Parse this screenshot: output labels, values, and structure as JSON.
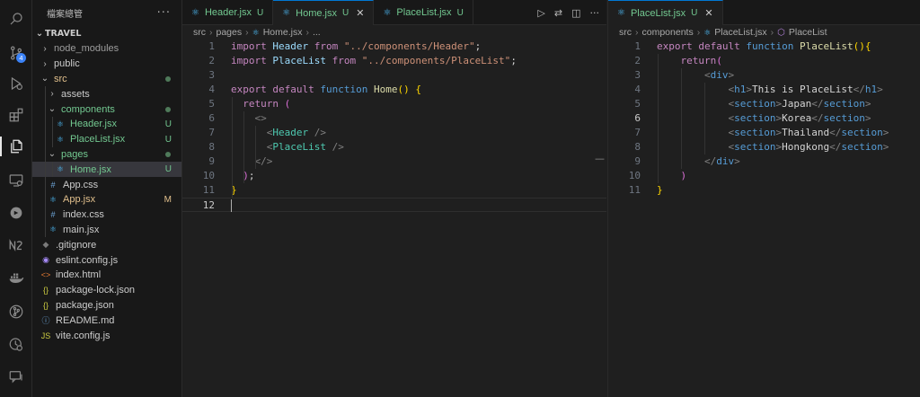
{
  "activity_bar": [
    {
      "name": "search-icon"
    },
    {
      "name": "source-control-icon",
      "badge": "4"
    },
    {
      "name": "run-debug-icon"
    },
    {
      "name": "extensions-icon"
    },
    {
      "name": "explorer-icon"
    },
    {
      "name": "remote-explorer-icon"
    },
    {
      "name": "tanstack-icon"
    },
    {
      "name": "n2-icon"
    },
    {
      "name": "docker-icon"
    },
    {
      "name": "git-graph-icon"
    },
    {
      "name": "timeline-icon"
    },
    {
      "name": "chat-icon"
    }
  ],
  "sidebar": {
    "title": "檔案總管",
    "menu": "···",
    "root": "TRAVEL",
    "items": [
      {
        "label": "node_modules",
        "depth": 1,
        "kind": "folder",
        "open": false,
        "color": "gray",
        "icon": ""
      },
      {
        "label": "public",
        "depth": 1,
        "kind": "folder",
        "open": false,
        "color": "normal",
        "icon": ""
      },
      {
        "label": "src",
        "depth": 1,
        "kind": "folder",
        "open": true,
        "color": "gold",
        "dot": true
      },
      {
        "label": "assets",
        "depth": 2,
        "kind": "folder",
        "open": false,
        "color": "normal"
      },
      {
        "label": "components",
        "depth": 2,
        "kind": "folder",
        "open": true,
        "color": "green",
        "dot": true
      },
      {
        "label": "Header.jsx",
        "depth": 3,
        "kind": "file",
        "icon": "react",
        "color": "green",
        "status": "U"
      },
      {
        "label": "PlaceList.jsx",
        "depth": 3,
        "kind": "file",
        "icon": "react",
        "color": "green",
        "status": "U"
      },
      {
        "label": "pages",
        "depth": 2,
        "kind": "folder",
        "open": true,
        "color": "green",
        "dot": true
      },
      {
        "label": "Home.jsx",
        "depth": 3,
        "kind": "file",
        "icon": "react",
        "color": "green",
        "status": "U",
        "selected": true
      },
      {
        "label": "App.css",
        "depth": 2,
        "kind": "file",
        "icon": "css",
        "color": "normal"
      },
      {
        "label": "App.jsx",
        "depth": 2,
        "kind": "file",
        "icon": "react",
        "color": "gold",
        "status": "M"
      },
      {
        "label": "index.css",
        "depth": 2,
        "kind": "file",
        "icon": "css",
        "color": "normal"
      },
      {
        "label": "main.jsx",
        "depth": 2,
        "kind": "file",
        "icon": "react",
        "color": "normal"
      },
      {
        "label": ".gitignore",
        "depth": 1,
        "kind": "file",
        "icon": "git",
        "color": "normal"
      },
      {
        "label": "eslint.config.js",
        "depth": 1,
        "kind": "file",
        "icon": "eslint",
        "color": "normal"
      },
      {
        "label": "index.html",
        "depth": 1,
        "kind": "file",
        "icon": "html",
        "color": "normal"
      },
      {
        "label": "package-lock.json",
        "depth": 1,
        "kind": "file",
        "icon": "json",
        "color": "normal"
      },
      {
        "label": "package.json",
        "depth": 1,
        "kind": "file",
        "icon": "json",
        "color": "normal"
      },
      {
        "label": "README.md",
        "depth": 1,
        "kind": "file",
        "icon": "info",
        "color": "normal"
      },
      {
        "label": "vite.config.js",
        "depth": 1,
        "kind": "file",
        "icon": "js",
        "color": "normal"
      }
    ]
  },
  "editor_left": {
    "tabs": [
      {
        "label": "Header.jsx",
        "status": "U",
        "active": false
      },
      {
        "label": "Home.jsx",
        "status": "U",
        "active": true,
        "close": "✕"
      },
      {
        "label": "PlaceList.jsx",
        "status": "U",
        "active": false
      }
    ],
    "breadcrumb": [
      "src",
      "pages",
      "Home.jsx",
      "..."
    ],
    "lines": [
      {
        "n": "1",
        "html": "<span class='kw2'>import</span> <span class='id'>Header</span> <span class='kw2'>from</span> <span class='str'>\"../components/Header\"</span><span class='plain'>;</span>"
      },
      {
        "n": "2",
        "html": "<span class='kw2'>import</span> <span class='id'>PlaceList</span> <span class='kw2'>from</span> <span class='str'>\"../components/PlaceList\"</span><span class='plain'>;</span>"
      },
      {
        "n": "3",
        "html": ""
      },
      {
        "n": "4",
        "html": "<span class='kw2'>export</span> <span class='kw2'>default</span> <span class='kw'>function</span> <span class='fn'>Home</span><span class='br1'>()</span> <span class='br1'>{</span>"
      },
      {
        "n": "5",
        "html": "  <span class='kw2'>return</span> <span class='br2'>(</span>"
      },
      {
        "n": "6",
        "html": "    <span class='pun'>&lt;&gt;</span>"
      },
      {
        "n": "7",
        "html": "      <span class='pun'>&lt;</span><span class='comp'>Header</span> <span class='pun'>/&gt;</span>"
      },
      {
        "n": "8",
        "html": "      <span class='pun'>&lt;</span><span class='comp'>PlaceList</span> <span class='pun'>/&gt;</span>"
      },
      {
        "n": "9",
        "html": "    <span class='pun'>&lt;/&gt;</span>"
      },
      {
        "n": "10",
        "html": "  <span class='br2'>)</span><span class='plain'>;</span>"
      },
      {
        "n": "11",
        "html": "<span class='br1'>}</span>"
      },
      {
        "n": "12",
        "html": "<span class='cursor'></span>",
        "current": true
      }
    ]
  },
  "editor_right": {
    "tabs": [
      {
        "label": "PlaceList.jsx",
        "status": "U",
        "active": true,
        "close": "✕"
      }
    ],
    "breadcrumb": [
      "src",
      "components",
      "PlaceList.jsx",
      "PlaceList"
    ],
    "lines": [
      {
        "n": "1",
        "html": "<span class='kw2'>export</span> <span class='kw2'>default</span> <span class='kw'>function</span> <span class='fn'>PlaceList</span><span class='br1'>(){</span>"
      },
      {
        "n": "2",
        "html": "    <span class='kw2'>return</span><span class='br2'>(</span>"
      },
      {
        "n": "3",
        "html": "        <span class='pun'>&lt;</span><span class='tag'>div</span><span class='pun'>&gt;</span>"
      },
      {
        "n": "4",
        "html": "            <span class='pun'>&lt;</span><span class='tag'>h1</span><span class='pun'>&gt;</span><span class='plain'>This is PlaceList</span><span class='pun'>&lt;/</span><span class='tag'>h1</span><span class='pun'>&gt;</span>"
      },
      {
        "n": "5",
        "html": "            <span class='pun'>&lt;</span><span class='tag'>section</span><span class='pun'>&gt;</span><span class='plain'>Japan</span><span class='pun'>&lt;/</span><span class='tag'>section</span><span class='pun'>&gt;</span>"
      },
      {
        "n": "6",
        "html": "            <span class='pun'>&lt;</span><span class='tag'>section</span><span class='pun'>&gt;</span><span class='plain'>Korea</span><span class='pun'>&lt;/</span><span class='tag'>section</span><span class='pun'>&gt;</span>",
        "current": true
      },
      {
        "n": "7",
        "html": "            <span class='pun'>&lt;</span><span class='tag'>section</span><span class='pun'>&gt;</span><span class='plain'>Thailand</span><span class='pun'>&lt;/</span><span class='tag'>section</span><span class='pun'>&gt;</span>"
      },
      {
        "n": "8",
        "html": "            <span class='pun'>&lt;</span><span class='tag'>section</span><span class='pun'>&gt;</span><span class='plain'>Hongkong</span><span class='pun'>&lt;/</span><span class='tag'>section</span><span class='pun'>&gt;</span>"
      },
      {
        "n": "9",
        "html": "        <span class='pun'>&lt;/</span><span class='tag'>div</span><span class='pun'>&gt;</span>"
      },
      {
        "n": "10",
        "html": "    <span class='br2'>)</span>"
      },
      {
        "n": "11",
        "html": "<span class='br1'>}</span>"
      }
    ]
  },
  "colors": {
    "accent": "#0078d4",
    "untracked": "#73c991",
    "modified": "#e2c08d",
    "badge": "#3b82f6"
  }
}
